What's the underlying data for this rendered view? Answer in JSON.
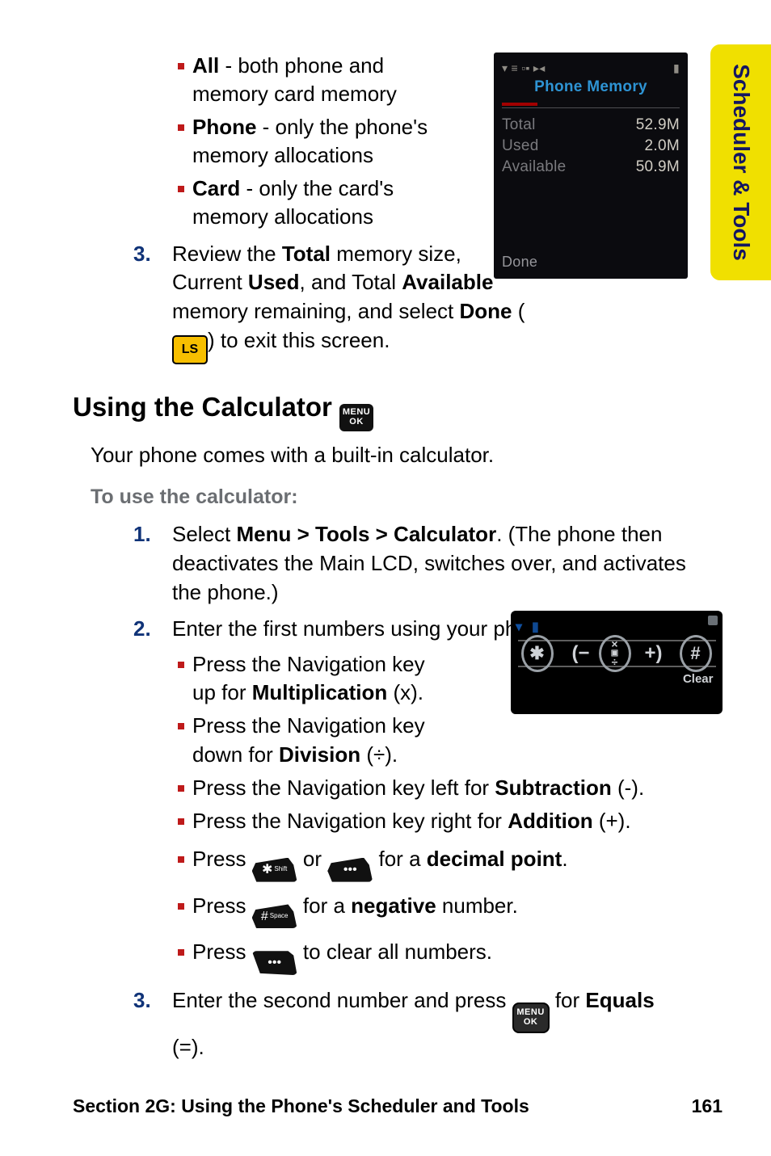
{
  "side_tab": "Scheduler & Tools",
  "mem_bullets": [
    {
      "term": "All",
      "desc": " - both phone and memory card memory"
    },
    {
      "term": "Phone",
      "desc": " - only the phone's memory allocations"
    },
    {
      "term": "Card",
      "desc": " - only the card's memory allocations"
    }
  ],
  "step3_line1_a": "Review the ",
  "step3_line1_b": "Total",
  "step3_line1_c": " memory size, Current ",
  "step3_line1_d": "Used",
  "step3_line1_e": ", and Total ",
  "step3_line1_f": "Available",
  "step3_line1_g": " memory remaining, and select ",
  "step3_done": "Done",
  "step3_paren_open": " (",
  "step3_paren_close": ") to exit this screen.",
  "ls_label": "LS",
  "phone_mem": {
    "title": "Phone Memory",
    "rows": [
      {
        "label": "Total",
        "value": "52.9M"
      },
      {
        "label": "Used",
        "value": "2.0M"
      },
      {
        "label": "Available",
        "value": "50.9M"
      }
    ],
    "done": "Done"
  },
  "h2": "Using the Calculator",
  "intro": "Your phone comes with a built-in calculator.",
  "subhead": "To use the calculator:",
  "calc_step1_a": "Select ",
  "calc_step1_b": "Menu > Tools > Calculator",
  "calc_step1_c": ". (The phone then deactivates the Main LCD, switches over, and activates the phone.)",
  "calc_step2": "Enter the first numbers using your phone's keypad.",
  "calc_bullets": [
    {
      "pre": "Press the Navigation key up for ",
      "term": "Multiplication",
      "post": " (x).",
      "narrow": true
    },
    {
      "pre": "Press the Navigation key down for ",
      "term": "Division",
      "post": " (÷).",
      "narrow": true
    },
    {
      "pre": "Press the Navigation key left for ",
      "term": "Subtraction",
      "post": " (-)."
    },
    {
      "pre": "Press the Navigation key right for ",
      "term": "Addition",
      "post": " (+)."
    }
  ],
  "dec_a": "Press ",
  "dec_b": " or ",
  "dec_c": " for a ",
  "dec_term": "decimal point",
  "dec_d": ".",
  "neg_a": "Press ",
  "neg_b": " for a ",
  "neg_term": "negative",
  "neg_c": " number.",
  "clr_a": "Press ",
  "clr_b": " to clear all numbers.",
  "calc_step3_a": "Enter the second number and press ",
  "calc_step3_b": " for ",
  "calc_step3_term": "Equals",
  "calc_step3_c": " (=).",
  "menu_key_top": "MENU",
  "menu_key_bottom": "OK",
  "key_star": "✱",
  "key_star_sub": "Shift",
  "key_hash": "#",
  "key_hash_sub": "Space",
  "key_dots": "•••",
  "calc_mock": {
    "star": "✱",
    "left": "−",
    "mid_top": "×",
    "mid_bot": "÷",
    "right": "+",
    "hash": "#",
    "clear": "Clear"
  },
  "footer_left": "Section 2G: Using the Phone's Scheduler and Tools",
  "footer_right": "161"
}
